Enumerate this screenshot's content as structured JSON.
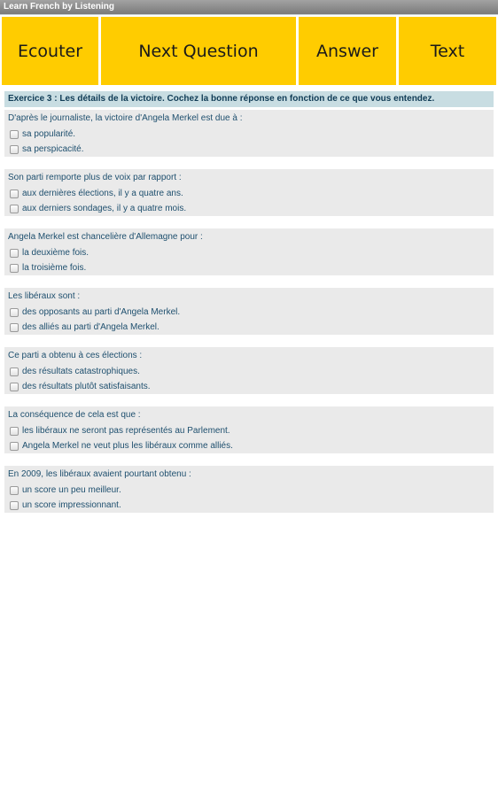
{
  "app": {
    "title": "Learn French by Listening"
  },
  "toolbar": {
    "listen_label": "Ecouter",
    "next_question_label": "Next Question",
    "answer_label": "Answer",
    "text_label": "Text",
    "accent_color": "#ffcc00"
  },
  "exercise": {
    "header": "Exercice 3 : Les détails de la victoire. Cochez la bonne réponse en fonction de ce que vous entendez.",
    "questions": [
      {
        "text": "D'après le journaliste, la victoire d'Angela Merkel est due à :",
        "options": [
          "sa popularité.",
          "sa perspicacité."
        ]
      },
      {
        "text": "Son parti remporte plus de voix par rapport :",
        "options": [
          "aux dernières élections, il y a quatre ans.",
          "aux derniers sondages, il y a quatre mois."
        ]
      },
      {
        "text": "Angela Merkel est chancelière d'Allemagne pour :",
        "options": [
          "la deuxième fois.",
          "la troisième fois."
        ]
      },
      {
        "text": "Les libéraux sont :",
        "options": [
          "des opposants au parti d'Angela Merkel.",
          "des alliés au parti d'Angela Merkel."
        ]
      },
      {
        "text": "Ce parti a obtenu à ces élections :",
        "options": [
          "des résultats catastrophiques.",
          "des résultats plutôt satisfaisants."
        ]
      },
      {
        "text": "La conséquence de cela est que :",
        "options": [
          "les libéraux ne seront pas représentés au Parlement.",
          "Angela Merkel ne veut plus les libéraux comme alliés."
        ]
      },
      {
        "text": "En 2009, les libéraux avaient pourtant obtenu :",
        "options": [
          "un score un peu meilleur.",
          "un score impressionnant."
        ]
      }
    ]
  }
}
